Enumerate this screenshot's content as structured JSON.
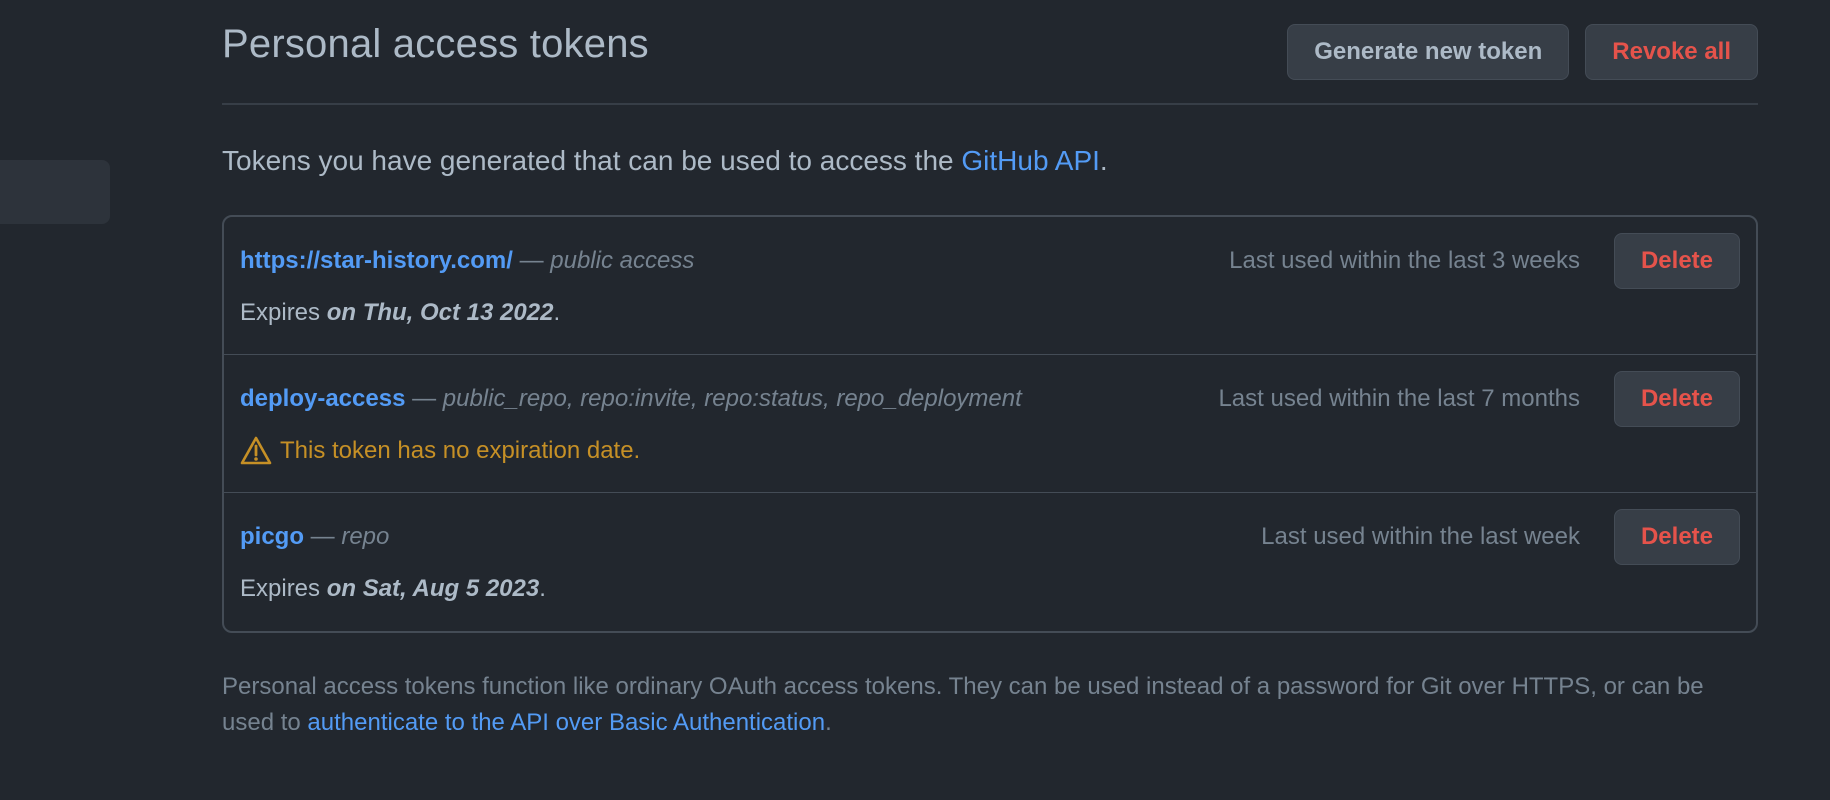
{
  "header": {
    "title": "Personal access tokens",
    "generate_label": "Generate new token",
    "revoke_label": "Revoke all"
  },
  "intro": {
    "text_before": "Tokens you have generated that can be used to access the ",
    "link_text": "GitHub API",
    "text_after": "."
  },
  "tokens": [
    {
      "name": "https://star-history.com/",
      "dash": " — ",
      "scopes": "public access",
      "last_used": "Last used within the last 3 weeks",
      "expiry_prefix": "Expires ",
      "expiry_date": "on Thu, Oct 13 2022",
      "expiry_suffix": ".",
      "delete_label": "Delete"
    },
    {
      "name": "deploy-access",
      "dash": " — ",
      "scopes": "public_repo, repo:invite, repo:status, repo_deployment",
      "last_used": "Last used within the last 7 months",
      "warning": "This token has no expiration date.",
      "delete_label": "Delete"
    },
    {
      "name": "picgo",
      "dash": " — ",
      "scopes": "repo",
      "last_used": "Last used within the last week",
      "expiry_prefix": "Expires ",
      "expiry_date": "on Sat, Aug 5 2023",
      "expiry_suffix": ".",
      "delete_label": "Delete"
    }
  ],
  "footer": {
    "text_before": "Personal access tokens function like ordinary OAuth access tokens. They can be used instead of a password for Git over HTTPS, or can be used to ",
    "link_text": "authenticate to the API over Basic Authentication",
    "text_after": "."
  },
  "colors": {
    "background": "#22272e",
    "link": "#539bf5",
    "danger": "#e5534b",
    "warning": "#c69026",
    "muted": "#768390"
  },
  "icons": {
    "warning": "alert-triangle-icon"
  }
}
